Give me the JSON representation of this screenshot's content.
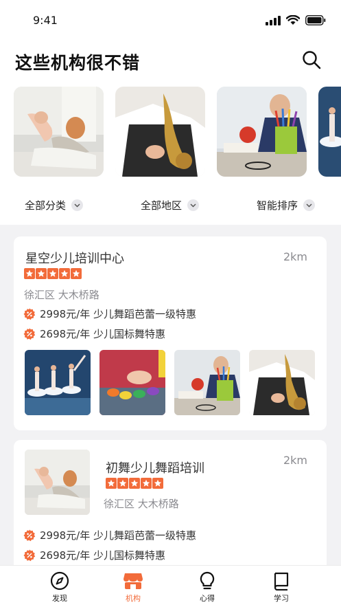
{
  "status": {
    "time": "9:41"
  },
  "header": {
    "title": "这些机构很不错"
  },
  "carousel": {
    "items": [
      {
        "name": "mother-child-photo"
      },
      {
        "name": "saxophone-photo"
      },
      {
        "name": "boy-pencils-photo"
      },
      {
        "name": "ballet-photo"
      }
    ]
  },
  "filters": {
    "category": "全部分类",
    "region": "全部地区",
    "sort": "智能排序"
  },
  "listings": [
    {
      "name": "星空少儿培训中心",
      "distance": "2km",
      "rating": 5,
      "address": "徐汇区 大木桥路",
      "offers": [
        "2998元/年 少儿舞蹈芭蕾一级特惠",
        "2698元/年 少儿国标舞特惠"
      ]
    },
    {
      "name": "初舞少儿舞蹈培训",
      "distance": "2km",
      "rating": 5,
      "address": "徐汇区 大木桥路",
      "offers": [
        "2998元/年 少儿舞蹈芭蕾一级特惠",
        "2698元/年 少儿国标舞特惠"
      ]
    }
  ],
  "tabbar": {
    "tabs": [
      {
        "label": "发现",
        "icon": "compass-icon"
      },
      {
        "label": "机构",
        "icon": "store-icon",
        "active": true
      },
      {
        "label": "心得",
        "icon": "lightbulb-icon"
      },
      {
        "label": "学习",
        "icon": "book-icon"
      }
    ]
  },
  "colors": {
    "accent": "#f26b3a",
    "muted": "#8a8a8f"
  }
}
